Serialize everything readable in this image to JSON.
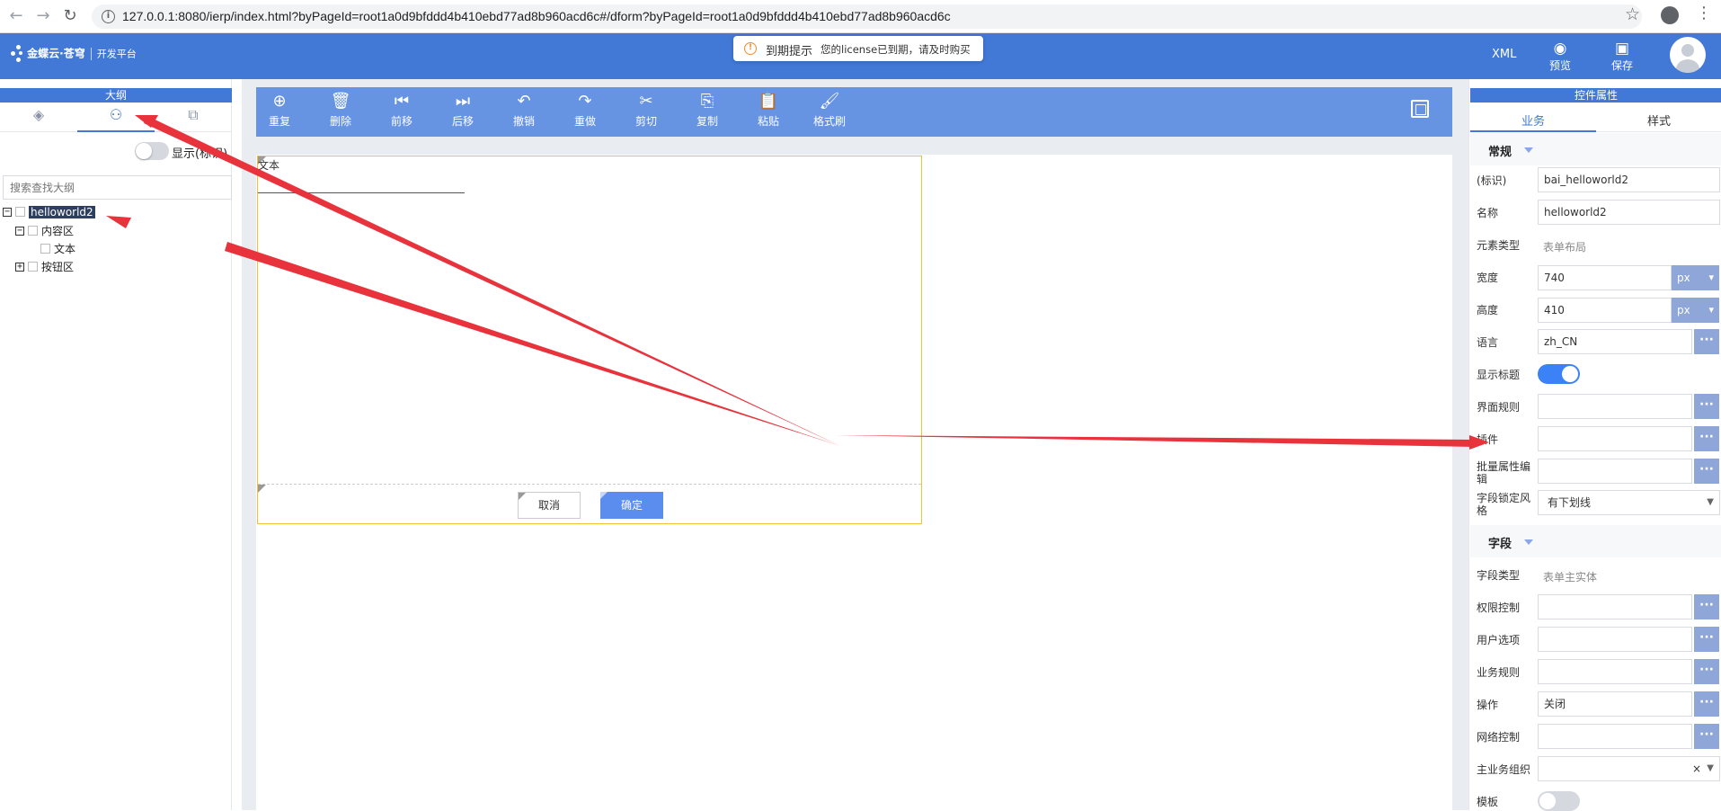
{
  "browser": {
    "url": "127.0.0.1:8080/ierp/index.html?byPageId=root1a0d9bfddd4b410ebd77ad8b960acd6c#/dform?byPageId=root1a0d9bfddd4b410ebd77ad8b960acd6c"
  },
  "header": {
    "logo_main": "金蝶云·苍穹",
    "logo_sub": "开发平台",
    "notice_title": "到期提示",
    "notice_message": "您的license已到期，请及时购买",
    "xml_label": "XML",
    "preview_label": "预览",
    "save_label": "保存"
  },
  "outline": {
    "title": "大纲",
    "show_id_label": "显示(标识)",
    "search_placeholder": "搜索查找大纲",
    "tree": {
      "root": "helloworld2",
      "content_area": "内容区",
      "text": "文本",
      "button_area": "按钮区"
    }
  },
  "toolbar": {
    "items": [
      "重复",
      "删除",
      "前移",
      "后移",
      "撤销",
      "重做",
      "剪切",
      "复制",
      "粘贴",
      "格式刷"
    ]
  },
  "form": {
    "text_label": "文本",
    "cancel_label": "取消",
    "ok_label": "确定"
  },
  "properties": {
    "title": "控件属性",
    "tab_business": "业务",
    "tab_style": "样式",
    "section_general": "常规",
    "section_field": "字段",
    "labels": {
      "id": "(标识)",
      "name": "名称",
      "element_type": "元素类型",
      "width": "宽度",
      "height": "高度",
      "language": "语言",
      "show_title": "显示标题",
      "ui_rules": "界面规则",
      "plugins": "插件",
      "batch_edit": "批量属性编辑",
      "field_lock_style": "字段锁定风格",
      "field_type": "字段类型",
      "permission": "权限控制",
      "user_options": "用户选项",
      "business_rules": "业务规则",
      "operation": "操作",
      "network_control": "网络控制",
      "main_org": "主业务组织",
      "template": "模板"
    },
    "values": {
      "id": "bai_helloworld2",
      "name": "helloworld2",
      "element_type": "表单布局",
      "width": "740",
      "width_unit": "px",
      "height": "410",
      "height_unit": "px",
      "language": "zh_CN",
      "field_lock_style": "有下划线",
      "field_type": "表单主实体",
      "operation": "关闭",
      "dots": "···",
      "clear": "×"
    },
    "show_title_on": true,
    "template_on": false
  },
  "colors": {
    "brand": "#4278d6",
    "toolbar": "#6693e2",
    "annotation": "#e8323c",
    "selection_border": "#f1c232"
  }
}
